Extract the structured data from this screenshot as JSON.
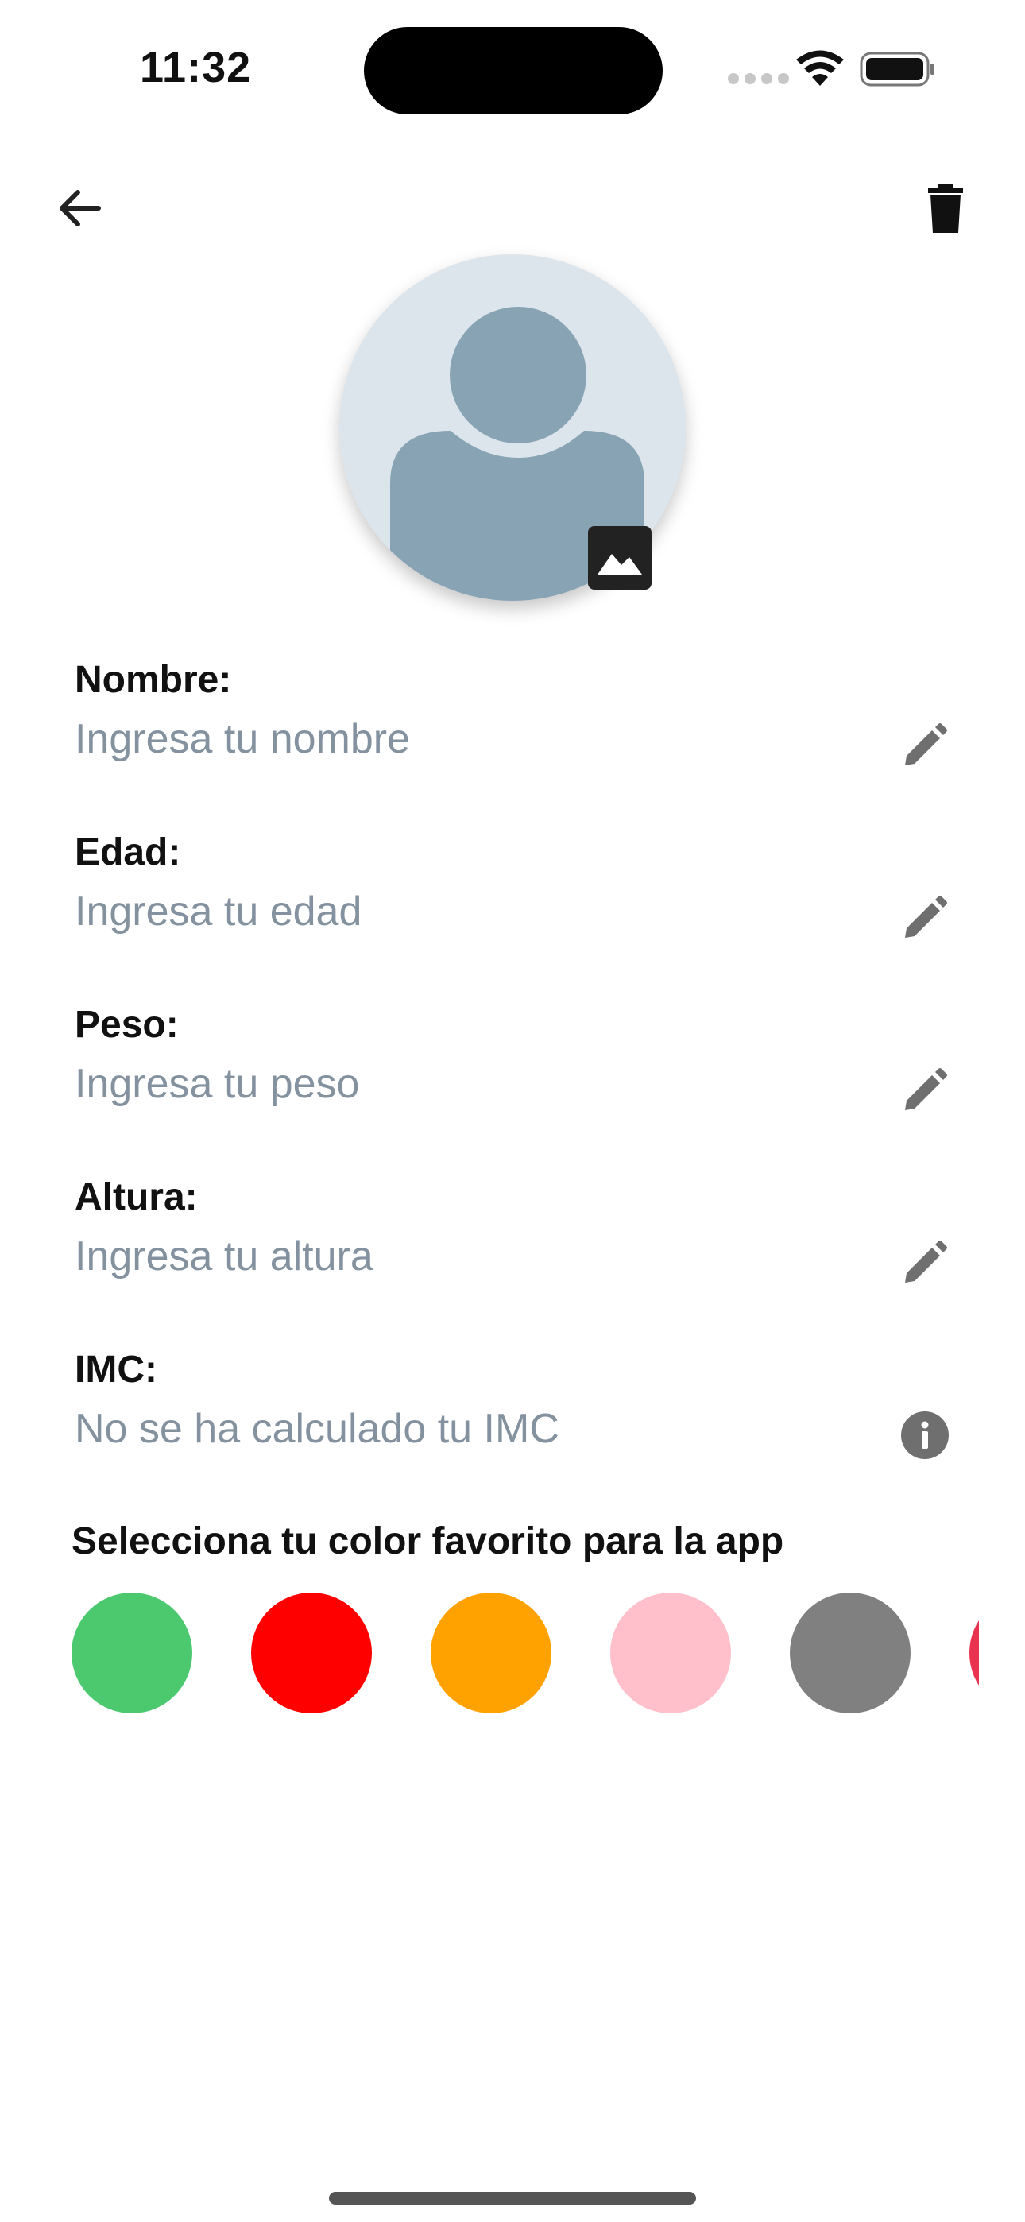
{
  "status_bar": {
    "time": "11:32"
  },
  "nav": {
    "back_icon": "arrow-left-icon",
    "delete_icon": "trash-icon"
  },
  "avatar": {
    "placeholder_icon": "person-silhouette-icon",
    "photo_icon": "image-icon"
  },
  "fields": [
    {
      "label": "Nombre:",
      "placeholder": "Ingresa tu nombre",
      "action_icon": "pencil-icon"
    },
    {
      "label": "Edad:",
      "placeholder": "Ingresa tu edad",
      "action_icon": "pencil-icon"
    },
    {
      "label": "Peso:",
      "placeholder": "Ingresa tu peso",
      "action_icon": "pencil-icon"
    },
    {
      "label": "Altura:",
      "placeholder": "Ingresa tu altura",
      "action_icon": "pencil-icon"
    },
    {
      "label": "IMC:",
      "placeholder": "No se ha calculado tu IMC",
      "action_icon": "info-icon"
    }
  ],
  "colors": {
    "title": "Selecciona tu color favorito para la app",
    "options": [
      "#4cc96f",
      "#ff0000",
      "#ffa200",
      "#ffc0cb",
      "#808080",
      "#e8324f"
    ]
  }
}
